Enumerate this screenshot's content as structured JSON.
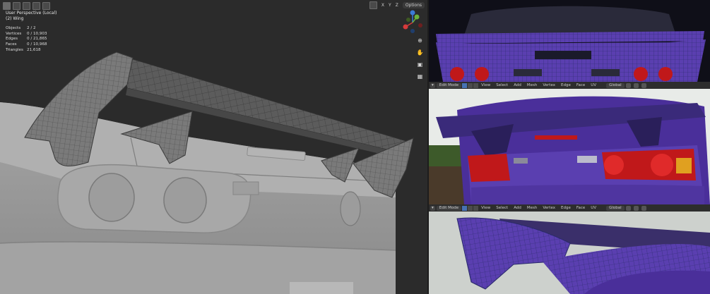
{
  "viewport": {
    "title": "User Perspective (Local)",
    "object": "(2) Wing",
    "stats": [
      {
        "label": "Objects",
        "value": "2 / 2"
      },
      {
        "label": "Vertices",
        "value": "0 / 10,903"
      },
      {
        "label": "Edges",
        "value": "0 / 21,865"
      },
      {
        "label": "Faces",
        "value": "0 / 10,968"
      },
      {
        "label": "Triangles",
        "value": "21,618"
      }
    ],
    "axes": [
      "X",
      "Y",
      "Z"
    ],
    "options_label": "Options",
    "gizmo_axes": [
      "Y",
      "Z",
      "X"
    ]
  },
  "toolbar": {
    "mode": "Edit Mode",
    "menus": [
      "View",
      "Select",
      "Add",
      "Mesh",
      "Vertex",
      "Edge",
      "Face",
      "UV"
    ],
    "orientation": "Global"
  },
  "colors": {
    "paint_purple": "#5a3fb0",
    "wire_blue": "#2a2a6a",
    "clay_gray": "#9a9a9a",
    "taillight_red": "#c0181a",
    "accent_blue": "#4772b3"
  }
}
